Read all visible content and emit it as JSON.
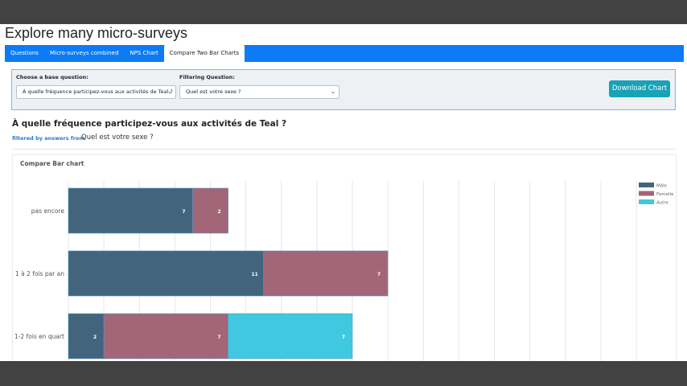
{
  "app": {
    "title": "Explore many micro-surveys"
  },
  "tabs": [
    {
      "label": "Questions",
      "active": false
    },
    {
      "label": "Micro-surveys combined",
      "active": false
    },
    {
      "label": "NPS Chart",
      "active": false
    },
    {
      "label": "Compare Two Bar Charts",
      "active": true
    }
  ],
  "filters": {
    "base_label": "Choose a base question:",
    "base_value": "À quelle fréquence participez-vous aux activités de Teal ?",
    "filter_label": "Filtering Question:",
    "filter_value": "Quel est votre sexe ?",
    "download_label": "Download Chart"
  },
  "question": {
    "title": "À quelle fréquence participez-vous aux activités de Teal ?",
    "filtered_by_label": "filtered by answers from",
    "filtered_by_question": "Quel est votre sexe ?"
  },
  "chart_card": {
    "title": "Compare Bar chart"
  },
  "colors": {
    "male": "#42657d",
    "female": "#a26678",
    "other": "#40c8e0",
    "tabs_bg": "#0d7bf3",
    "download": "#17a2b8"
  },
  "chart_data": {
    "type": "bar",
    "orientation": "horizontal",
    "stacked": true,
    "categories": [
      "pas encore",
      "1 à 2 fois par an",
      "1-2 fois en quart"
    ],
    "series": [
      {
        "name": "Mâle",
        "values": [
          7,
          11,
          2
        ]
      },
      {
        "name": "Femelle",
        "values": [
          2,
          7,
          7
        ]
      },
      {
        "name": "Autre",
        "values": [
          0,
          0,
          7
        ]
      }
    ],
    "xlim": [
      0,
      32
    ],
    "grid": true,
    "legend": "top-right"
  }
}
